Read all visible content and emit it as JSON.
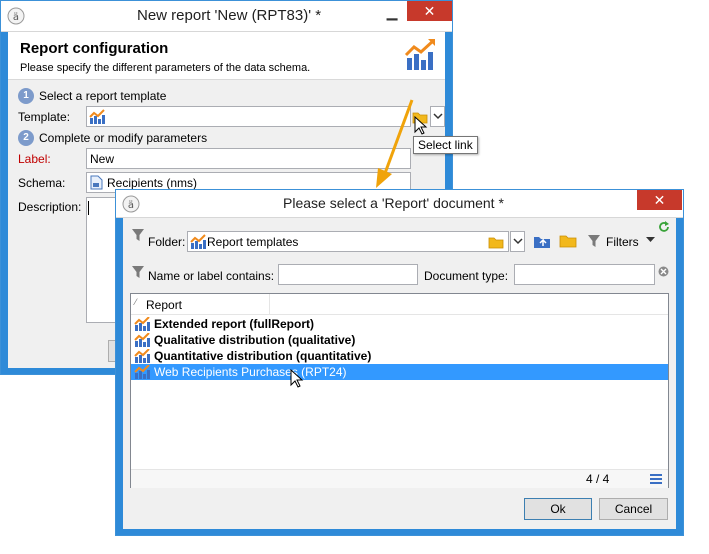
{
  "main_window": {
    "title": "New report 'New (RPT83)' *",
    "header": {
      "title": "Report configuration",
      "subtitle": "Please specify the different parameters of the data schema."
    },
    "step1": {
      "number": "1",
      "label": "Select a report template"
    },
    "template_label": "Template:",
    "step2": {
      "number": "2",
      "label": "Complete or modify parameters"
    },
    "label_label": "Label:",
    "label_value": "New",
    "schema_label": "Schema:",
    "schema_value": "Recipients (nms)",
    "description_label": "Description:",
    "tooltip": "Select link"
  },
  "dialog": {
    "title": "Please select a 'Report' document *",
    "folder_label": "Folder:",
    "folder_value": "Report templates",
    "filters_label": "Filters",
    "name_filter_label": "Name or label contains:",
    "name_filter_value": "",
    "doctype_label": "Document type:",
    "doctype_value": "",
    "column_header": "Report",
    "rows": [
      {
        "label": "Extended report (fullReport)"
      },
      {
        "label": "Qualitative distribution (qualitative)"
      },
      {
        "label": "Quantitative distribution (quantitative)"
      },
      {
        "label": "Web Recipients Purchases (RPT24)"
      }
    ],
    "count": "4 / 4",
    "ok_label": "Ok",
    "cancel_label": "Cancel"
  },
  "colors": {
    "window_border": "#2e8ad8",
    "close_button": "#c7392b",
    "selection": "#3399ff",
    "label_required": "#c00000",
    "annotation_arrow": "#f0a30a"
  }
}
